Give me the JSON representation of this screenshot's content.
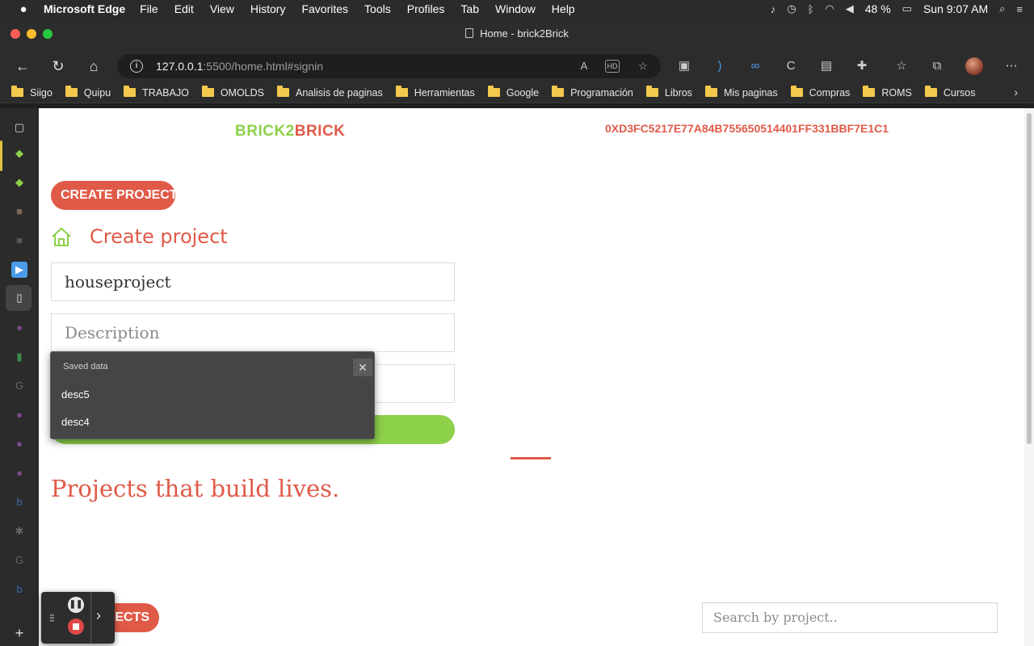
{
  "menubar": {
    "app_name": "Microsoft Edge",
    "items": [
      "File",
      "Edit",
      "View",
      "History",
      "Favorites",
      "Tools",
      "Profiles",
      "Tab",
      "Window",
      "Help"
    ],
    "battery": "48 %",
    "clock": "Sun 9:07 AM"
  },
  "window": {
    "tab_title": "Home - brick2Brick"
  },
  "address": {
    "host": "127.0.0.1",
    "rest": ":5500/home.html#signin"
  },
  "bookmarks": [
    "Siigo",
    "Quipu",
    "TRABAJO",
    "OMOLDS",
    "Analisis de paginas",
    "Herramientas",
    "Google",
    "Programación",
    "Libros",
    "Mis paginas",
    "Compras",
    "ROMS",
    "Cursos"
  ],
  "page": {
    "logo_part1": "BRICK2",
    "logo_part2": "BRICK",
    "wallet_address": "0XD3FC5217E77A84B755650514401FF331BBF7E1C1",
    "create_project_button": "CREATE PROJECT",
    "section_title": "Create project",
    "name_value": "houseproject",
    "description_placeholder": "Description",
    "tagline": "Projects that build lives.",
    "projects_button": "JECTS",
    "search_placeholder": "Search by project.."
  },
  "autofill": {
    "header": "Saved data",
    "items": [
      "desc5",
      "desc4"
    ]
  },
  "colors": {
    "brand_green": "#8dd14a",
    "brand_red": "#e05a48"
  }
}
